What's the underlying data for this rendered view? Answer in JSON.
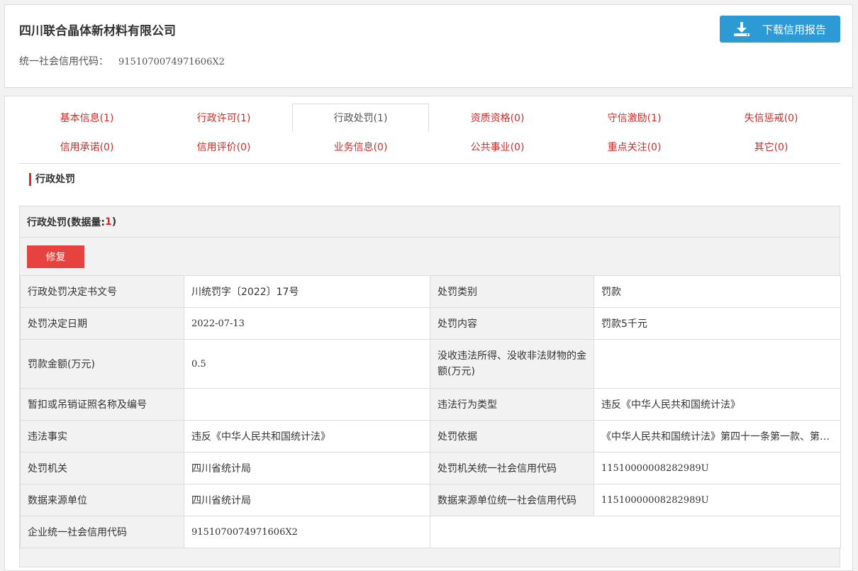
{
  "header": {
    "company_name": "四川联合晶体新材料有限公司",
    "credit_code_label": "统一社会信用代码：",
    "credit_code": "9151070074971606X2",
    "download_label": "下载信用报告"
  },
  "tabs": [
    {
      "label": "基本信息(1)",
      "active": false
    },
    {
      "label": "行政许可(1)",
      "active": false
    },
    {
      "label": "行政处罚(1)",
      "active": true
    },
    {
      "label": "资质资格(0)",
      "active": false
    },
    {
      "label": "守信激励(1)",
      "active": false
    },
    {
      "label": "失信惩戒(0)",
      "active": false
    },
    {
      "label": "信用承诺(0)",
      "active": false
    },
    {
      "label": "信用评价(0)",
      "active": false
    },
    {
      "label": "业务信息(0)",
      "active": false
    },
    {
      "label": "公共事业(0)",
      "active": false
    },
    {
      "label": "重点关注(0)",
      "active": false
    },
    {
      "label": "其它(0)",
      "active": false
    }
  ],
  "section": {
    "title": "行政处罚",
    "box_title_prefix": "行政处罚(数据量: ",
    "box_count": "1",
    "box_title_suffix": ")",
    "fix_label": "修复"
  },
  "details": {
    "r1": {
      "k1": "行政处罚决定书文号",
      "v1": "川统罚字〔2022〕17号",
      "k2": "处罚类别",
      "v2": "罚款"
    },
    "r2": {
      "k1": "处罚决定日期",
      "v1": "2022-07-13",
      "k2": "处罚内容",
      "v2": "罚款5千元"
    },
    "r3": {
      "k1": "罚款金额(万元)",
      "v1": "0.5",
      "k2": "没收违法所得、没收非法财物的金额(万元)",
      "v2": ""
    },
    "r4": {
      "k1": "暂扣或吊销证照名称及编号",
      "v1": "",
      "k2": "违法行为类型",
      "v2": "违反《中华人民共和国统计法》"
    },
    "r5": {
      "k1": "违法事实",
      "v1": "违反《中华人民共和国统计法》",
      "k2": "处罚依据",
      "v2": "《中华人民共和国统计法》第四十一条第一款、第四十二条"
    },
    "r6": {
      "k1": "处罚机关",
      "v1": "四川省统计局",
      "k2": "处罚机关统一社会信用代码",
      "v2": "11510000008282989U"
    },
    "r7": {
      "k1": "数据来源单位",
      "v1": "四川省统计局",
      "k2": "数据来源单位统一社会信用代码",
      "v2": "11510000008282989U"
    },
    "r8": {
      "k1": "企业统一社会信用代码",
      "v1": "9151070074971606X2"
    }
  },
  "colors": {
    "accent_red": "#c9302c",
    "button_blue": "#2b9ad5",
    "fix_red": "#e64340"
  }
}
